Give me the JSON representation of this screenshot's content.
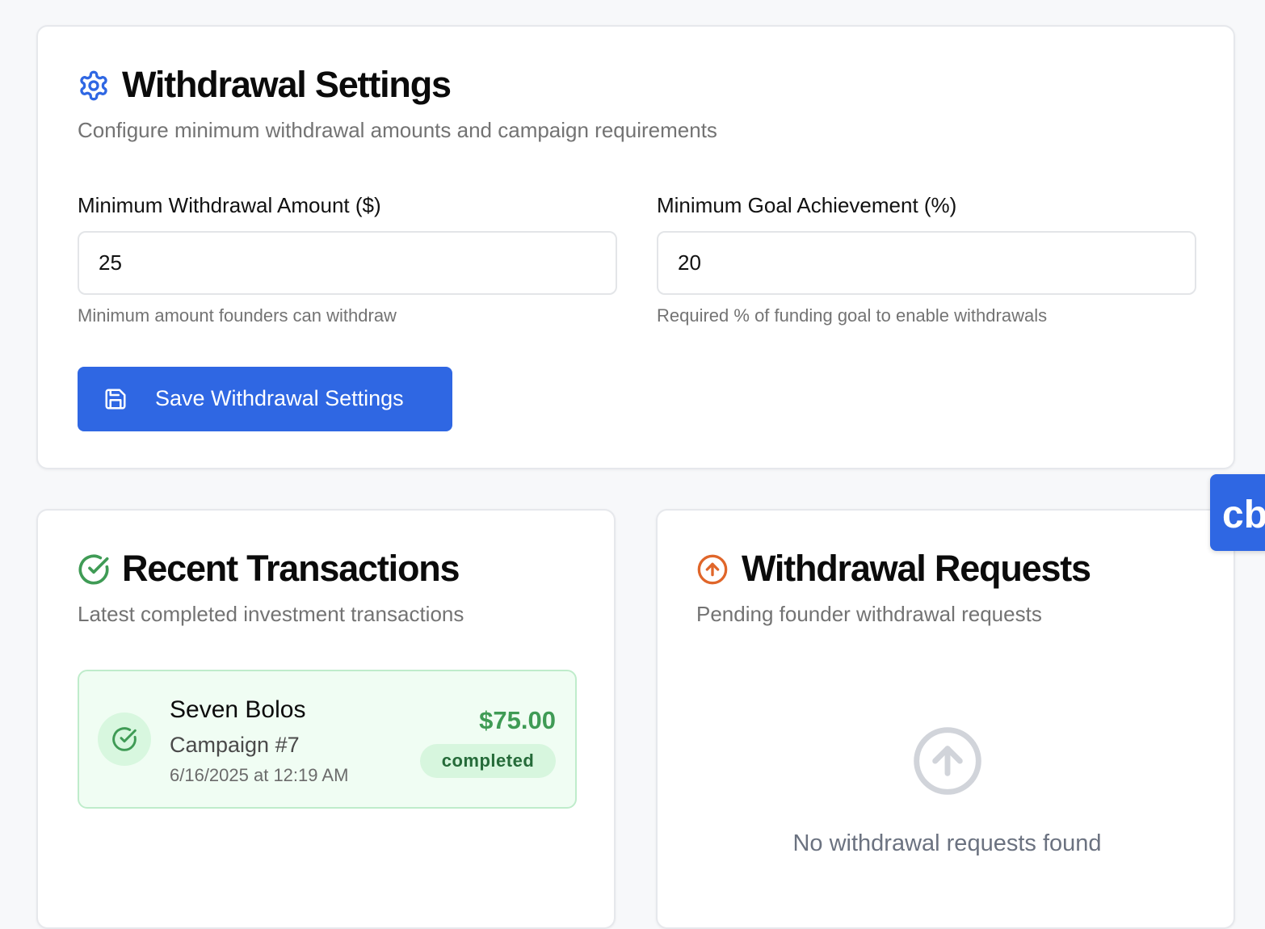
{
  "colors": {
    "accent_blue": "#2f67e3",
    "success_green": "#3f9b55",
    "warning_orange": "#e0662a",
    "muted_gray": "#737373"
  },
  "settings": {
    "title": "Withdrawal Settings",
    "subtitle": "Configure minimum withdrawal amounts and campaign requirements",
    "icon": "gear-icon",
    "min_amount": {
      "label": "Minimum Withdrawal Amount ($)",
      "value": "25",
      "hint": "Minimum amount founders can withdraw"
    },
    "min_goal": {
      "label": "Minimum Goal Achievement (%)",
      "value": "20",
      "hint": "Required % of funding goal to enable withdrawals"
    },
    "save_button": {
      "label": "Save Withdrawal Settings",
      "icon": "save-icon"
    }
  },
  "transactions": {
    "title": "Recent Transactions",
    "subtitle": "Latest completed investment transactions",
    "icon": "check-circle-icon",
    "items": [
      {
        "name": "Seven Bolos",
        "campaign": "Campaign #7",
        "date": "6/16/2025 at 12:19 AM",
        "amount": "$75.00",
        "status": "completed"
      }
    ]
  },
  "withdrawals": {
    "title": "Withdrawal Requests",
    "subtitle": "Pending founder withdrawal requests",
    "icon": "arrow-up-circle-icon",
    "empty_text": "No withdrawal requests found"
  },
  "widget": {
    "label": "cb"
  }
}
